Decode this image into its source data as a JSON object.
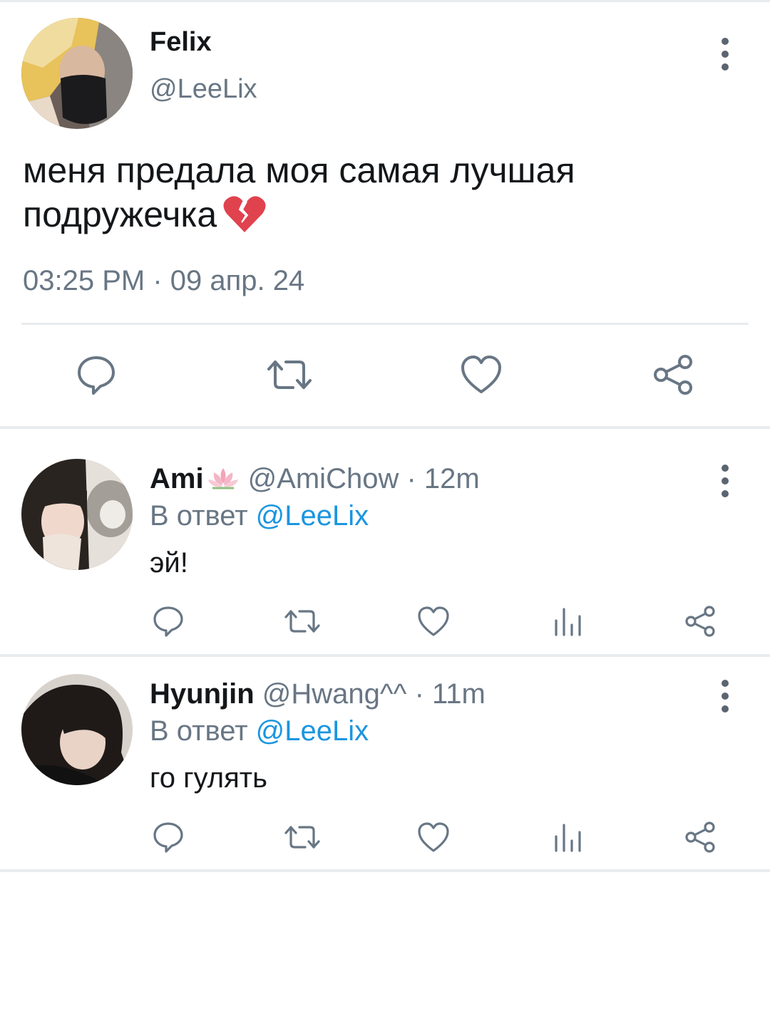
{
  "main_tweet": {
    "author_name": "Felix",
    "author_handle": "@LeeLix",
    "text": "меня предала моя самая лучшая подружечка",
    "emoji": "broken-heart-emoji",
    "timestamp": "03:25 PM · 09 апр. 24",
    "actions": [
      "reply-icon",
      "retweet-icon",
      "like-icon",
      "share-icon"
    ]
  },
  "replies": [
    {
      "name": "Ami",
      "name_emoji": "lotus-emoji",
      "handle_time": "@AmiChow · 12m",
      "reply_label": "В ответ",
      "reply_mention": "@LeeLix",
      "text": "эй!",
      "actions": [
        "reply-icon",
        "retweet-icon",
        "like-icon",
        "stats-icon",
        "share-icon"
      ]
    },
    {
      "name": "Hyunjin",
      "handle_time": "@Hwang^^ · 11m",
      "reply_label": "В ответ",
      "reply_mention": "@LeeLix",
      "text": "го гулять",
      "actions": [
        "reply-icon",
        "retweet-icon",
        "like-icon",
        "stats-icon",
        "share-icon"
      ]
    }
  ],
  "colors": {
    "text_primary": "#14171a",
    "text_secondary": "#687684",
    "mention": "#1b95e0",
    "divider": "#e9ecef",
    "icon": "#687684",
    "heart_emoji": "#e0424e"
  }
}
